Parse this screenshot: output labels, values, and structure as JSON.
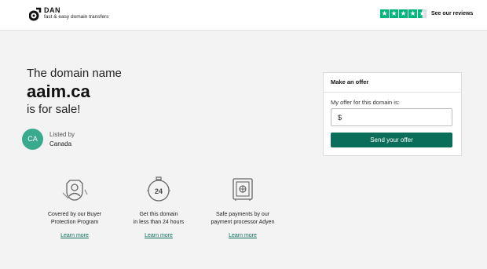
{
  "brand": {
    "name": "DAN",
    "tagline": "fast & easy domain transfers"
  },
  "trustpilot": {
    "rating_stars": 4.5,
    "label": "See our reviews",
    "color": "#00b67a"
  },
  "hero": {
    "pre": "The domain name",
    "domain": "aaim.ca",
    "post": "is for sale!"
  },
  "seller": {
    "initials": "CA",
    "listed_by": "Listed by",
    "country": "Canada"
  },
  "features": [
    {
      "icon": "shield-person-icon",
      "text": "Covered by our Buyer\nProtection Program",
      "link": "Learn more"
    },
    {
      "icon": "24-hours-icon",
      "text": "Get this domain\nin less than 24 hours",
      "link": "Learn more"
    },
    {
      "icon": "safe-icon",
      "text": "Safe payments by our\npayment processor Adyen",
      "link": "Learn more"
    }
  ],
  "offer": {
    "title": "Make an offer",
    "label": "My offer for this domain is:",
    "currency": "$",
    "button": "Send your offer"
  },
  "colors": {
    "accent": "#0b6e5a",
    "avatar": "#3aaa8c",
    "background": "#f3f3f3"
  }
}
